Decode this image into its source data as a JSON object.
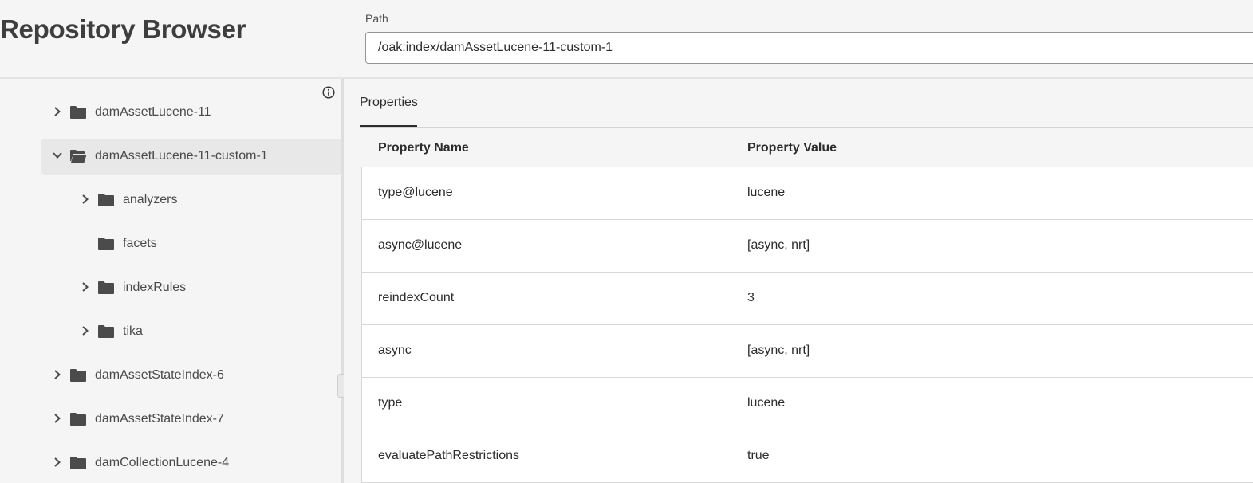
{
  "header": {
    "title": "Repository Browser",
    "path_label": "Path",
    "path_value": "/oak:index/damAssetLucene-11-custom-1"
  },
  "tree": {
    "items": [
      {
        "label": "damAssetLucene-11",
        "expanded": false,
        "has_children": true,
        "depth": 0
      },
      {
        "label": "damAssetLucene-11-custom-1",
        "expanded": true,
        "has_children": true,
        "depth": 0,
        "selected": true
      },
      {
        "label": "analyzers",
        "expanded": false,
        "has_children": true,
        "depth": 1
      },
      {
        "label": "facets",
        "expanded": false,
        "has_children": false,
        "depth": 1
      },
      {
        "label": "indexRules",
        "expanded": false,
        "has_children": true,
        "depth": 1
      },
      {
        "label": "tika",
        "expanded": false,
        "has_children": true,
        "depth": 1
      },
      {
        "label": "damAssetStateIndex-6",
        "expanded": false,
        "has_children": true,
        "depth": 0
      },
      {
        "label": "damAssetStateIndex-7",
        "expanded": false,
        "has_children": true,
        "depth": 0
      },
      {
        "label": "damCollectionLucene-4",
        "expanded": false,
        "has_children": true,
        "depth": 0
      }
    ]
  },
  "properties": {
    "tab_label": "Properties",
    "columns": [
      "Property Name",
      "Property Value"
    ],
    "rows": [
      {
        "name": "type@lucene",
        "value": "lucene"
      },
      {
        "name": "async@lucene",
        "value": "[async, nrt]"
      },
      {
        "name": "reindexCount",
        "value": "3"
      },
      {
        "name": "async",
        "value": "[async, nrt]"
      },
      {
        "name": "type",
        "value": "lucene"
      },
      {
        "name": "evaluatePathRestrictions",
        "value": "true"
      }
    ]
  },
  "colors": {
    "background": "#f5f5f5",
    "icon": "#4b4b4b",
    "selected_row": "#e8e8e8",
    "table_body": "#ffffff"
  }
}
